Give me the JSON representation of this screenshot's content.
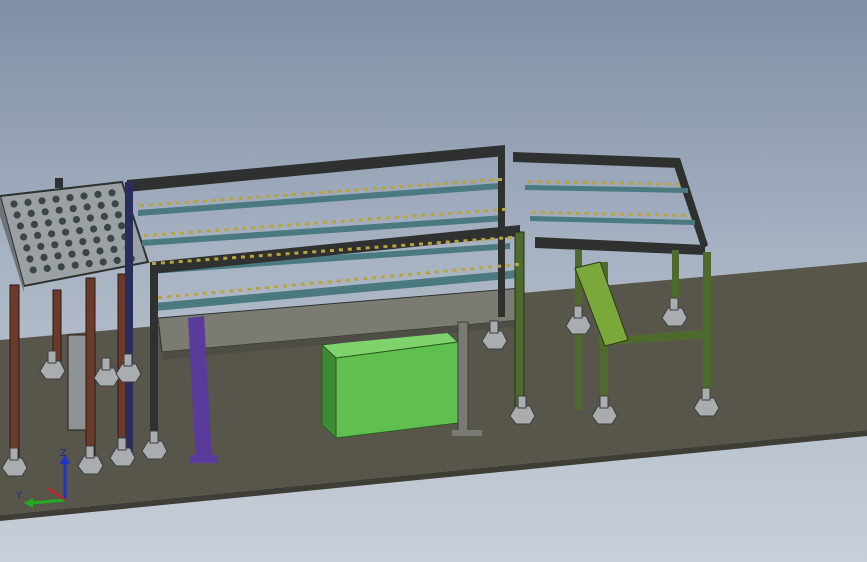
{
  "view": {
    "triad": {
      "z_label": "Z",
      "y_label": "Y"
    }
  },
  "colors": {
    "floor": "#58564a",
    "frame_dark": "#2e3130",
    "frame_green": "#4f6a2d",
    "frame_purple": "#5a3a9a",
    "leg_brown": "#6b3a2a",
    "roller": "#8a7a2a",
    "box_green": "#5fbf4f",
    "axis_z": "#2233cc",
    "axis_y": "#22aa22"
  }
}
